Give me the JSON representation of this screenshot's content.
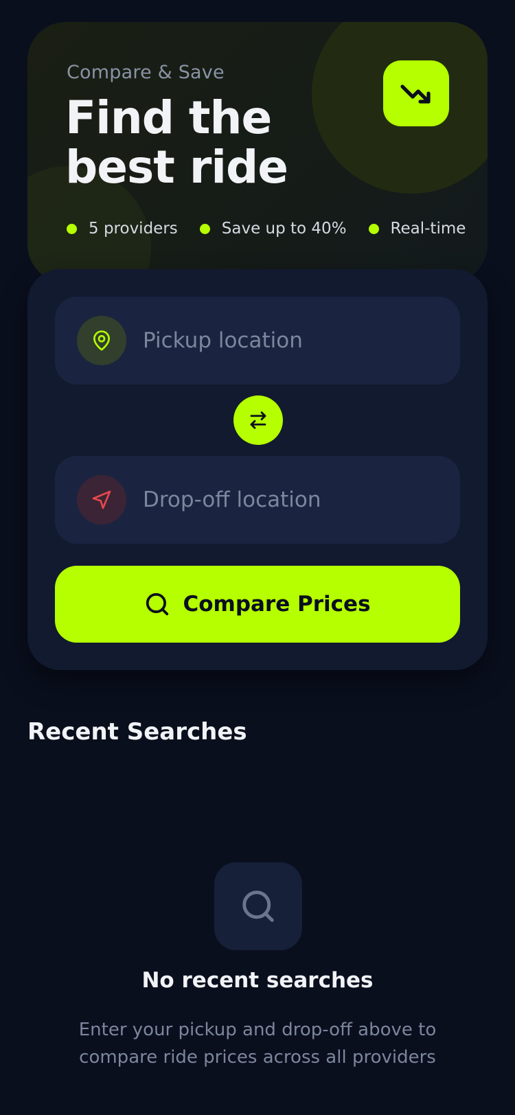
{
  "colors": {
    "background": "#0a0f1e",
    "accent": "#b5ff00",
    "card": "#121a30",
    "field": "#1a2440",
    "muted_text": "#7c869c",
    "dropoff_icon": "#e5484d"
  },
  "hero": {
    "eyebrow": "Compare & Save",
    "title_line1": "Find the",
    "title_line2": "best ride",
    "badge_icon": "trending-down-icon",
    "features": [
      {
        "label": "5 providers"
      },
      {
        "label": "Save up to 40%"
      },
      {
        "label": "Real-time"
      }
    ]
  },
  "search": {
    "pickup": {
      "placeholder": "Pickup location",
      "value": "",
      "icon": "map-pin-icon"
    },
    "dropoff": {
      "placeholder": "Drop-off location",
      "value": "",
      "icon": "navigation-arrow-icon"
    },
    "swap_icon": "swap-arrows-icon",
    "compare_label": "Compare Prices",
    "compare_icon": "search-icon"
  },
  "recent": {
    "title": "Recent Searches",
    "empty_icon": "search-icon",
    "empty_title": "No recent searches",
    "empty_desc_line1": "Enter your pickup and drop-off above to",
    "empty_desc_line2": "compare ride prices across all providers"
  }
}
